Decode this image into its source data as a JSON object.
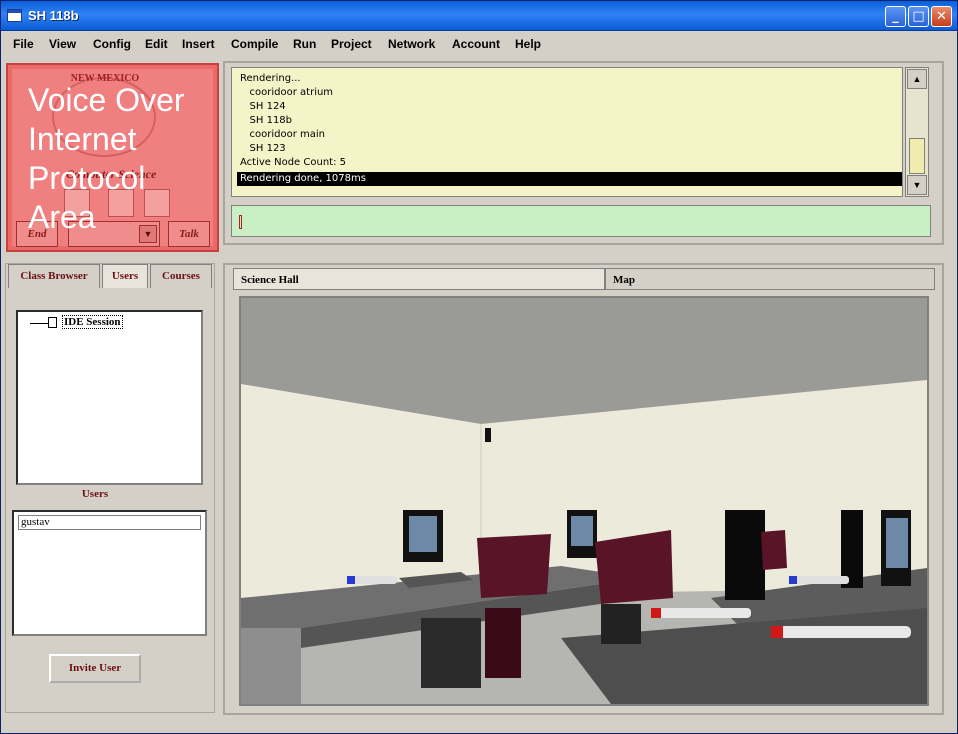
{
  "window": {
    "title": "SH 118b"
  },
  "menu": [
    "File",
    "View",
    "Config",
    "Edit",
    "Insert",
    "Compile",
    "Run",
    "Project",
    "Network",
    "Account",
    "Help"
  ],
  "voip": {
    "label": "Voice Over Internet Protocol Area",
    "seal_text": "NEW MEXICO",
    "dept_text": "Computer Science",
    "end_label": "End",
    "talk_label": "Talk"
  },
  "console": {
    "lines": [
      "Rendering...",
      "   cooridoor atrium",
      "   SH 124",
      "   SH 118b",
      "   cooridoor main",
      "   SH 123",
      "Active Node Count: 5"
    ],
    "selected_line": "Rendering done, 1078ms",
    "command_value": ""
  },
  "left_tabs": [
    "Class Browser",
    "Users",
    "Courses"
  ],
  "active_left_tab": "Users",
  "tree": {
    "root_label": "IDE Session"
  },
  "users": {
    "title": "Users",
    "items": [
      "gustav"
    ],
    "invite_label": "Invite User"
  },
  "view_tabs": [
    "Science Hall",
    "Map"
  ],
  "colors": {
    "title_bar": "#0a5fd8",
    "voip_overlay": "#ea6a6a",
    "console_bg": "#f5f3c8",
    "command_bg": "#c9f0c4",
    "tab_text": "#6a1010"
  }
}
